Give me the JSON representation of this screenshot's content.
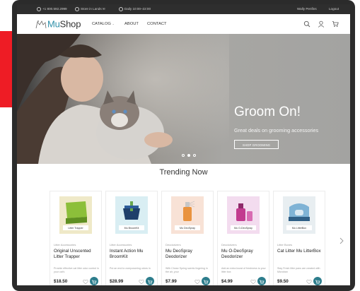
{
  "topbar": {
    "phone": "+1 800.592.2999",
    "store": "Store in Lands ✉",
    "hours": "Daily 10:00–22:00",
    "user": "Wally Penfins",
    "logout": "Logout"
  },
  "logo": {
    "prefix": "Mu",
    "suffix": "Shop"
  },
  "nav": {
    "catalog": "CATALOG",
    "about": "ABOUT",
    "contact": "CONTACT"
  },
  "hero": {
    "title": "Groom On!",
    "subtitle": "Great deals on grooming accessories",
    "button": "SHOP GROOMING"
  },
  "trending": {
    "title": "Trending Now"
  },
  "products": [
    {
      "category": "Litter Accessories",
      "name": "Original Unscented Litter Trapper",
      "description": "Provide effective cat litter odor control in your cat's",
      "price": "$18.50",
      "box_label": "Litter Trapper",
      "box_color": "#efe9c8"
    },
    {
      "category": "Litter Accessories",
      "name": "Instant Action Mu BroomKit",
      "description": "Put an end to overpowering odors in",
      "price": "$28.99",
      "box_label": "Mu BroomKit",
      "box_color": "#d9eef3"
    },
    {
      "category": "Deodorizers",
      "name": "Mu DeoSpray Deodorizer",
      "description": "With Chose Spring scents lingering in the air, your",
      "price": "$7.99",
      "box_label": "Mu DeoSpray",
      "box_color": "#f8e2d6"
    },
    {
      "category": "Deodorizers",
      "name": "Mu O-DeoSpray Deodorizer",
      "description": "Add an extra boost of freshness to your litter box",
      "price": "$4.99",
      "box_label": "Mu O-DeoSpray",
      "box_color": "#f3dcef"
    },
    {
      "category": "Litter Boxes",
      "name": "Cat Litter Mu LitterBox",
      "description": "Stay Fresh litter pans are created with Microban",
      "price": "$9.50",
      "box_label": "Mu LitterBox",
      "box_color": "#e8eef1"
    }
  ],
  "colors": {
    "accent": "#2e8fa8",
    "cart": "#2d7d8c",
    "topbar": "#2e2e2e",
    "red_block": "#ee1c25"
  }
}
